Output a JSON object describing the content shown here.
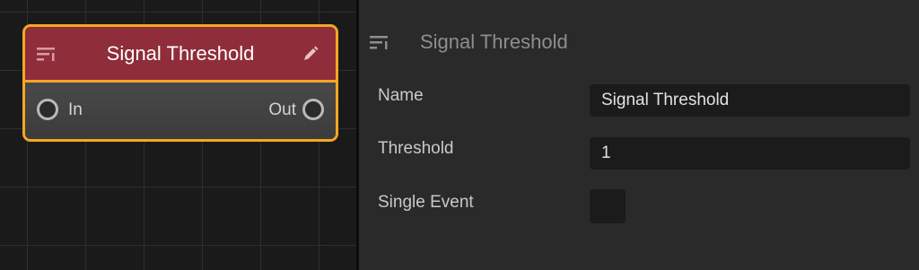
{
  "node": {
    "title": "Signal Threshold",
    "input_port": "In",
    "output_port": "Out",
    "header_color": "#8f2d3b",
    "selection_color": "#f5a623",
    "icons": [
      "list-icon",
      "pencil-icon"
    ]
  },
  "inspector": {
    "title": "Signal Threshold",
    "properties": [
      {
        "label": "Name",
        "value": "Signal Threshold"
      },
      {
        "label": "Threshold",
        "value": "1"
      },
      {
        "label": "Single Event",
        "checked": false
      }
    ]
  }
}
